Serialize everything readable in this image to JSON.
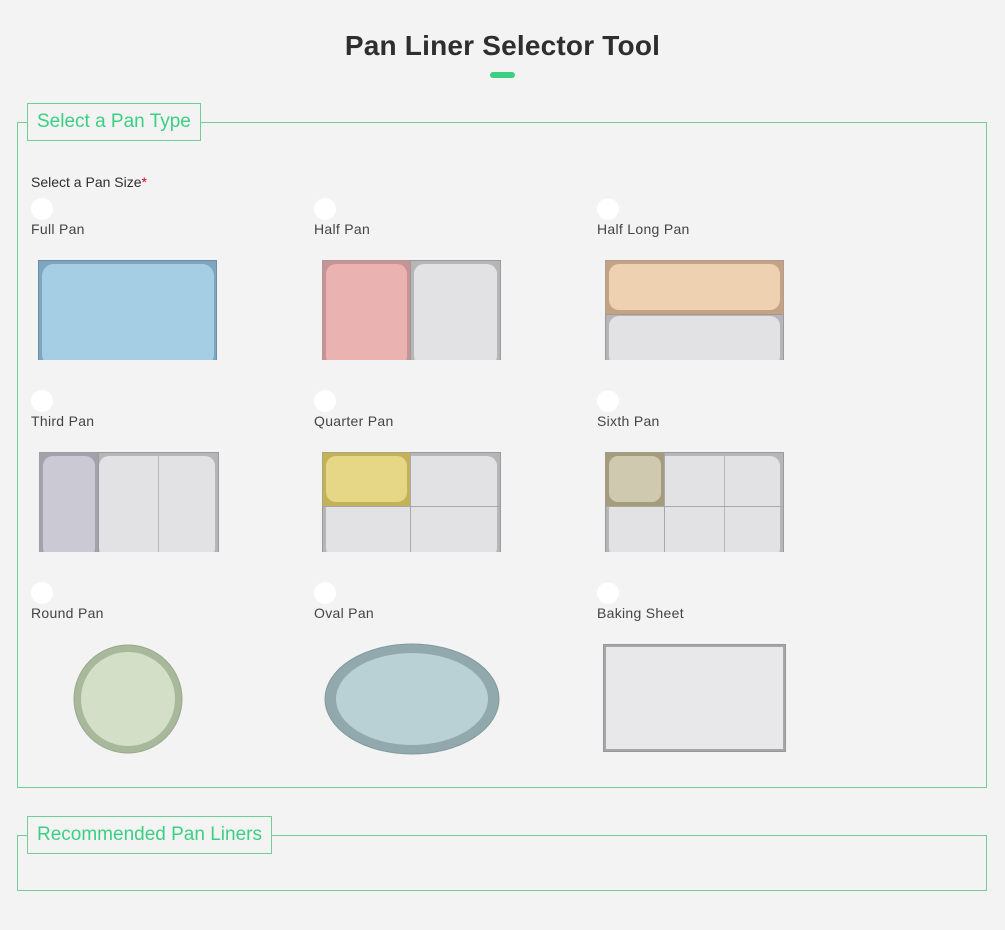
{
  "header": {
    "title": "Pan Liner Selector Tool"
  },
  "pan_type_section": {
    "legend": "Select a Pan Type",
    "size_label": "Select a Pan Size",
    "required_marker": "*",
    "options": [
      {
        "label": "Full Pan",
        "icon": "full-pan-icon",
        "color": "#a5cde3"
      },
      {
        "label": "Half Pan",
        "icon": "half-pan-icon",
        "color": "#eab3b2"
      },
      {
        "label": "Half Long Pan",
        "icon": "half-long-pan-icon",
        "color": "#edd1b0"
      },
      {
        "label": "Third Pan",
        "icon": "third-pan-icon",
        "color": "#cbc9d4"
      },
      {
        "label": "Quarter Pan",
        "icon": "quarter-pan-icon",
        "color": "#e6d787"
      },
      {
        "label": "Sixth Pan",
        "icon": "sixth-pan-icon",
        "color": "#cfc9b0"
      },
      {
        "label": "Round Pan",
        "icon": "round-pan-icon",
        "color": "#d3dfc7"
      },
      {
        "label": "Oval Pan",
        "icon": "oval-pan-icon",
        "color": "#b9d0d4"
      },
      {
        "label": "Baking Sheet",
        "icon": "baking-sheet-icon",
        "color": "#e8e8ea"
      }
    ]
  },
  "recommended_section": {
    "legend": "Recommended Pan Liners"
  },
  "colors": {
    "accent": "#3ccf83",
    "border": "#6fcf97",
    "required": "#d0021b",
    "background": "#f3f3f3"
  }
}
